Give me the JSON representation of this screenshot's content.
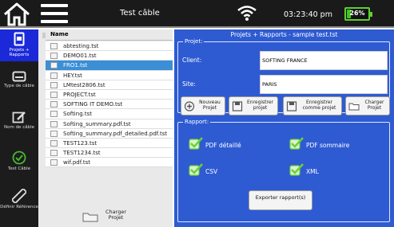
{
  "header": {
    "title": "Test câble",
    "time": "03:23:40 pm",
    "battery_label": "26%",
    "battery_level_percent": 26
  },
  "sidebar": {
    "items": [
      {
        "label": "Projets + Rapports",
        "active": true
      },
      {
        "label": "Type de câble",
        "active": false
      },
      {
        "label": "Nom de câble",
        "active": false
      },
      {
        "label": "Test Câble",
        "active": false
      },
      {
        "label": "Définir Référence",
        "active": false
      }
    ]
  },
  "file_list": {
    "header": "Name",
    "files": [
      "abtesting.tst",
      "DEMO01.tst",
      "FRO1.tst",
      "HEY.tst",
      "LMtest2806.tst",
      "PROJECT.tst",
      "SOFTING IT DEMO.tst",
      "Softing.tst",
      "Softing_summary.pdf.tst",
      "Softing_summary.pdf_detailed.pdf.tst",
      "TEST123.tst",
      "TEST1234.tst",
      "wif.pdf.tst"
    ],
    "selected_index": 2,
    "load_button": "Charger Projet"
  },
  "right_panel": {
    "title": "Projets + Rapports - sample test.tst",
    "project": {
      "legend": "Projet:",
      "client_label": "Client:",
      "client_value": "SOFTING FRANCE",
      "site_label": "Site:",
      "site_value": "PARIS"
    },
    "buttons": {
      "new": "Nouveau Projet",
      "save": "Enregistrer projet",
      "save_as": "Enregistrer comme projet",
      "load": "Charger Projet"
    },
    "report": {
      "legend": "Rapport:",
      "pdf_detailed": "PDF détaillé",
      "pdf_summary": "PDF sommaire",
      "csv": "CSV",
      "xml": "XML",
      "export": "Exporter rapport(s)"
    }
  },
  "colors": {
    "panel_blue": "#2e5bd2",
    "active_blue": "#1b29d8",
    "selected_row": "#3a8fd6",
    "check_green": "#6ccf3c",
    "battery_green": "#39c81c"
  }
}
